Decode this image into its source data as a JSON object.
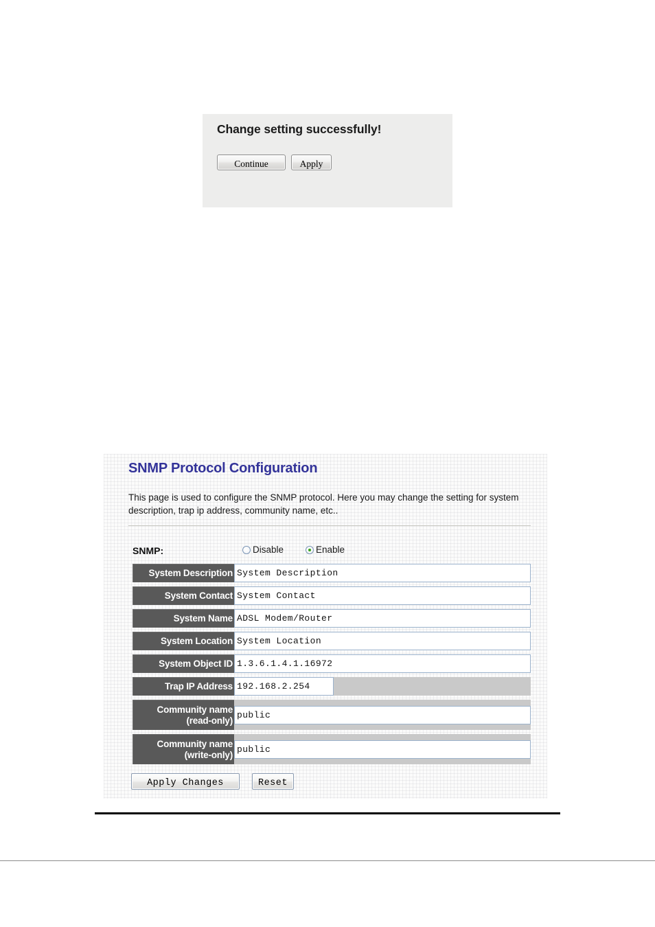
{
  "success_panel": {
    "title": "Change setting successfully!",
    "buttons": [
      {
        "name": "continue",
        "label": "Continue"
      },
      {
        "name": "apply",
        "label": "Apply"
      }
    ]
  },
  "snmp_panel": {
    "heading": "SNMP Protocol Configuration",
    "description": "This page is used to configure the SNMP protocol. Here you may change the setting for system description, trap ip address, community name, etc..",
    "snmp_toggle": {
      "label": "SNMP:",
      "options": [
        {
          "label": "Disable",
          "checked": false
        },
        {
          "label": "Enable",
          "checked": true
        }
      ]
    },
    "fields": [
      {
        "label": "System Description",
        "value": "System Description"
      },
      {
        "label": "System Contact",
        "value": "System Contact"
      },
      {
        "label": "System Name",
        "value": "ADSL Modem/Router"
      },
      {
        "label": "System Location",
        "value": "System Location"
      },
      {
        "label": "System Object ID",
        "value": "1.3.6.1.4.1.16972"
      },
      {
        "label": "Trap IP Address",
        "value": "192.168.2.254"
      },
      {
        "label_line1": "Community name",
        "label_line2": "(read-only)",
        "value": "public"
      },
      {
        "label_line1": "Community name",
        "label_line2": "(write-only)",
        "value": "public"
      }
    ],
    "actions": [
      {
        "name": "apply-changes",
        "label": "Apply Changes"
      },
      {
        "name": "reset",
        "label": "Reset"
      }
    ]
  },
  "colors": {
    "heading": "#333399",
    "label_cell": "#595959",
    "radio_selected_dot": "#37a318",
    "panel_background": "#fbfbfb",
    "success_panel_background": "#ededec",
    "shaded_cell": "#c9c9c9"
  }
}
